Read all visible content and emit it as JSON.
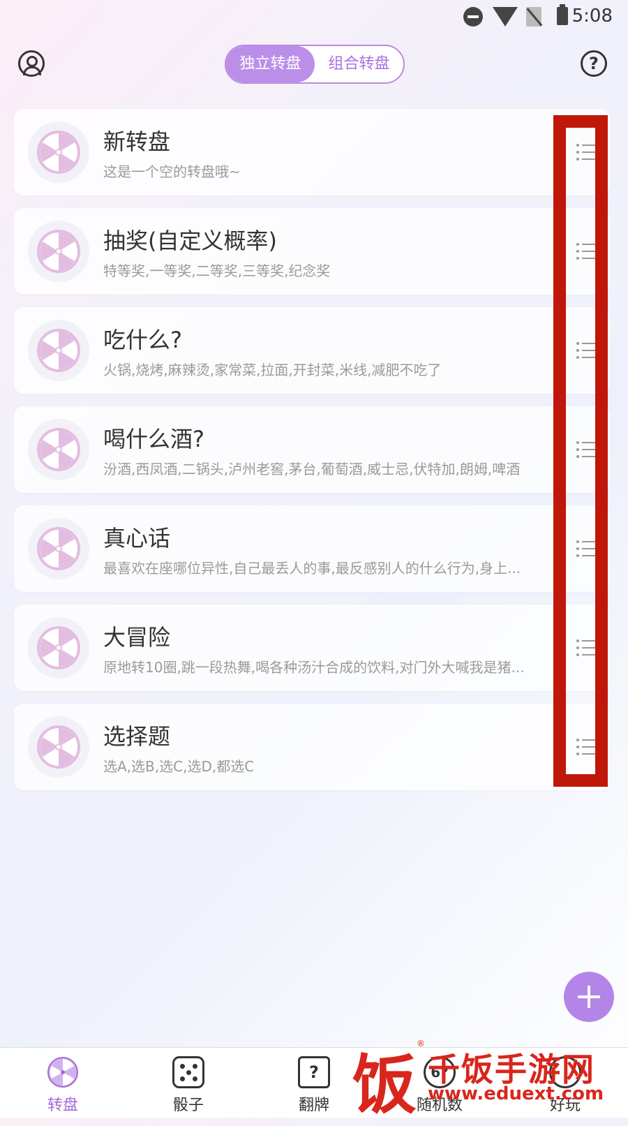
{
  "status_bar": {
    "time": "5:08"
  },
  "header": {
    "segments": [
      "独立转盘",
      "组合转盘"
    ],
    "active_segment": 0
  },
  "wheels": [
    {
      "title": "新转盘",
      "desc": "这是一个空的转盘哦~"
    },
    {
      "title": "抽奖(自定义概率)",
      "desc": "特等奖,一等奖,二等奖,三等奖,纪念奖"
    },
    {
      "title": "吃什么?",
      "desc": "火锅,烧烤,麻辣烫,家常菜,拉面,开封菜,米线,减肥不吃了"
    },
    {
      "title": "喝什么酒?",
      "desc": "汾酒,西凤酒,二锅头,泸州老窖,茅台,葡萄酒,威士忌,伏特加,朗姆,啤酒"
    },
    {
      "title": "真心话",
      "desc": "最喜欢在座哪位异性,自己最丢人的事,最反感别人的什么行为,身上..."
    },
    {
      "title": "大冒险",
      "desc": "原地转10圈,跳一段热舞,喝各种汤汁合成的饮料,对门外大喊我是猪..."
    },
    {
      "title": "选择题",
      "desc": "选A,选B,选C,选D,都选C"
    }
  ],
  "tabs": [
    {
      "label": "转盘",
      "icon": "wheel-icon"
    },
    {
      "label": "骰子",
      "icon": "dice-icon"
    },
    {
      "label": "翻牌",
      "icon": "card-flip-icon"
    },
    {
      "label": "随机数",
      "icon": "random-number-icon"
    },
    {
      "label": "好玩",
      "icon": "fun-icon"
    }
  ],
  "tab_icon_text": {
    "card": "?",
    "number": "6?"
  },
  "watermark": {
    "char": "饭",
    "title": "千饭手游网",
    "url": "www.eduext.com"
  },
  "colors": {
    "accent": "#bb8fe8",
    "highlight": "#c0170b",
    "watermark": "#d9261c"
  }
}
